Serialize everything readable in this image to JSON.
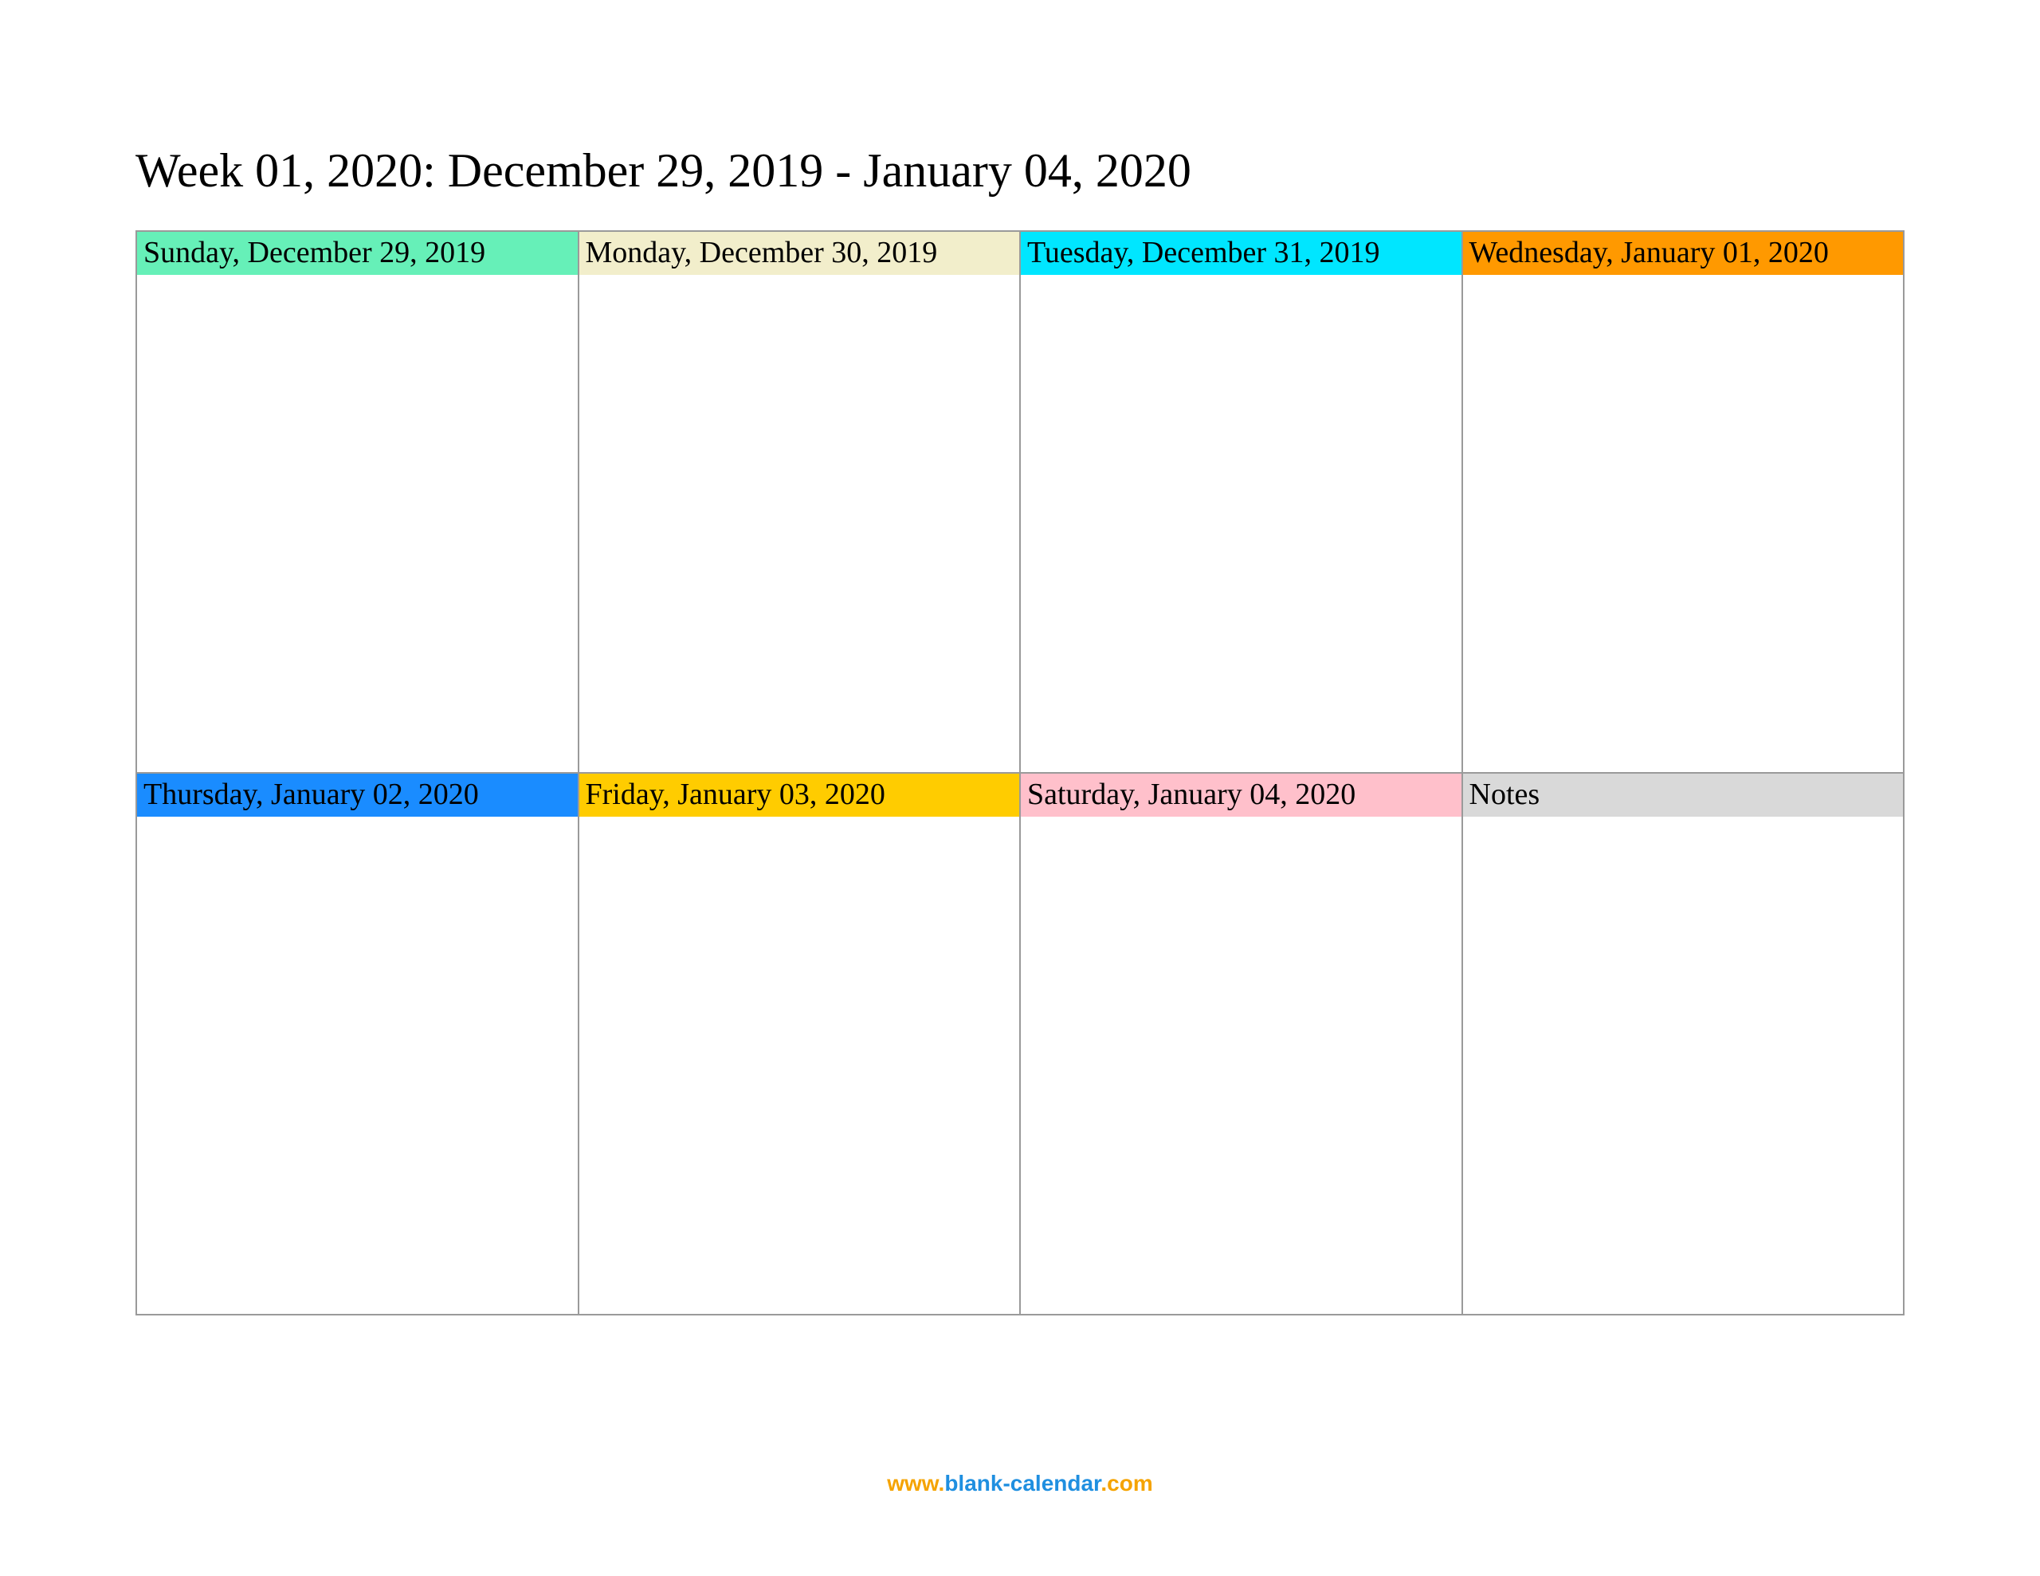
{
  "title": "Week 01, 2020: December 29, 2019 - January 04, 2020",
  "cells": [
    {
      "label": "Sunday, December 29, 2019",
      "bg": "#66f0b8"
    },
    {
      "label": "Monday, December 30, 2019",
      "bg": "#f2eecb"
    },
    {
      "label": "Tuesday, December 31, 2019",
      "bg": "#00e6ff"
    },
    {
      "label": "Wednesday, January 01, 2020",
      "bg": "#ff9900"
    },
    {
      "label": "Thursday, January 02, 2020",
      "bg": "#1a8cff"
    },
    {
      "label": "Friday, January 03, 2020",
      "bg": "#ffcc00"
    },
    {
      "label": "Saturday, January 04, 2020",
      "bg": "#ffc0cb"
    },
    {
      "label": "Notes",
      "bg": "#d9d9d9"
    }
  ],
  "footer": {
    "p1": "www.",
    "p2": "blank-calendar",
    "p3": ".com"
  }
}
